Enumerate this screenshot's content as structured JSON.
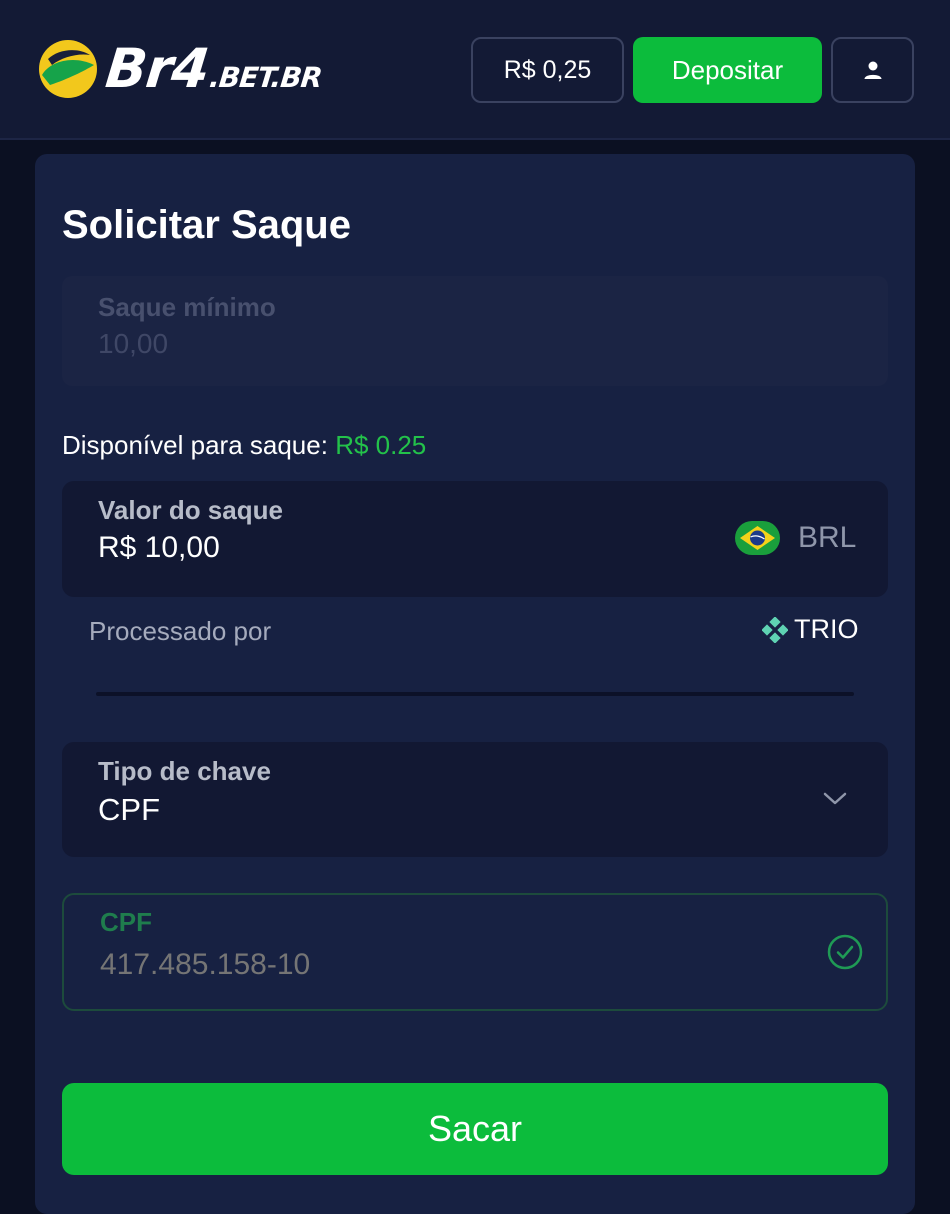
{
  "header": {
    "logo_main": "Br4",
    "logo_sub": ".BET.BR",
    "balance": "R$ 0,25",
    "deposit_label": "Depositar",
    "user_icon": "user-icon"
  },
  "form": {
    "title": "Solicitar Saque",
    "minimum": {
      "label": "Saque mínimo",
      "value": "10,00"
    },
    "available": {
      "label": "Disponível para saque:",
      "amount": "R$ 0.25"
    },
    "amount": {
      "label": "Valor do saque",
      "value": "R$ 10,00",
      "currency": "BRL",
      "flag_icon": "brazil-flag-icon"
    },
    "processed": {
      "label": "Processado por",
      "provider": "TRIO"
    },
    "key_type": {
      "label": "Tipo de chave",
      "value": "CPF"
    },
    "cpf": {
      "label": "CPF",
      "placeholder": "417.485.158-10"
    },
    "submit_label": "Sacar"
  },
  "colors": {
    "accent_green": "#0cbc3c",
    "background": "#0b1022",
    "card": "#172142"
  }
}
